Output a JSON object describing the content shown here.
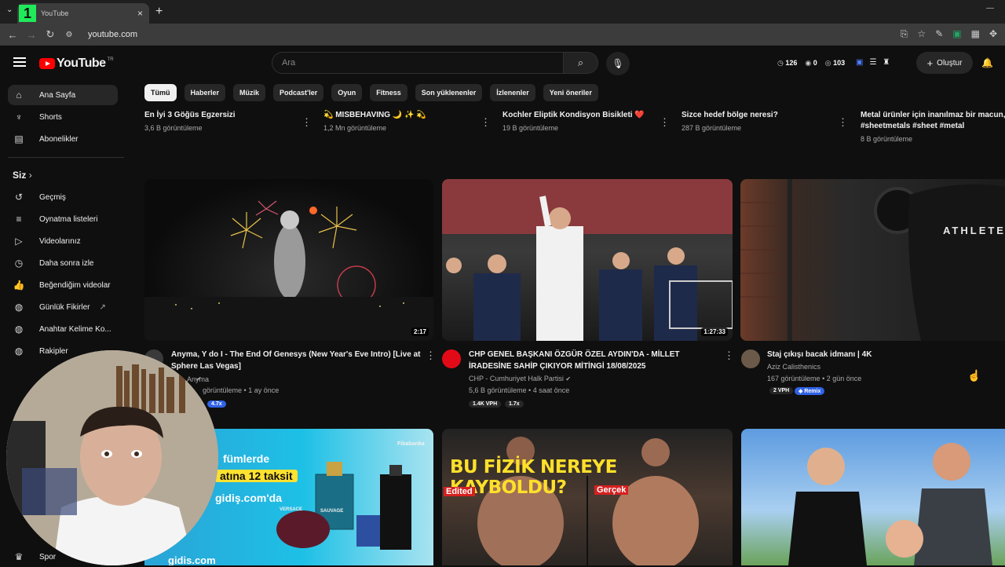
{
  "browser": {
    "tab_title": "YouTube",
    "tab_badge": "1",
    "url": "youtube.com"
  },
  "header": {
    "logo_text": "YouTube",
    "logo_region": "TR",
    "search_placeholder": "Ara",
    "stats": {
      "a": "126",
      "b": "0",
      "c": "103"
    },
    "create_label": "Oluştur"
  },
  "sidebar": {
    "top": [
      {
        "label": "Ana Sayfa",
        "icon": "home-icon"
      },
      {
        "label": "Shorts",
        "icon": "shorts-icon"
      },
      {
        "label": "Abonelikler",
        "icon": "subscriptions-icon"
      }
    ],
    "you_header": "Siz",
    "you": [
      {
        "label": "Geçmiş",
        "icon": "history-icon"
      },
      {
        "label": "Oynatma listeleri",
        "icon": "playlists-icon"
      },
      {
        "label": "Videolarınız",
        "icon": "your-videos-icon"
      },
      {
        "label": "Daha sonra izle",
        "icon": "watch-later-icon"
      },
      {
        "label": "Beğendiğim videolar",
        "icon": "liked-icon"
      },
      {
        "label": "Günlük Fikirler",
        "icon": "playlist-icon"
      },
      {
        "label": "Anahtar Kelime Ko...",
        "icon": "playlist-icon"
      },
      {
        "label": "Rakipler",
        "icon": "playlist-icon"
      }
    ],
    "bottom_label": "Spor"
  },
  "chips": [
    "Tümü",
    "Haberler",
    "Müzik",
    "Podcast'ler",
    "Oyun",
    "Fitness",
    "Son yüklenenler",
    "İzlenenler",
    "Yeni öneriler"
  ],
  "top_row": [
    {
      "title": "En İyi 3 Göğüs Egzersizi",
      "meta": "3,6 B görüntüleme"
    },
    {
      "title": "💫 MISBEHAVING 🌙 ✨ 💫",
      "meta": "1,2 Mn görüntüleme"
    },
    {
      "title": "Kochler Eliptik Kondisyon Bisikleti ❤️",
      "meta": "19 B görüntüleme"
    },
    {
      "title": "Sizce hedef bölge neresi?",
      "meta": "287 B görüntüleme"
    },
    {
      "title": "Metal ürünler için inanılmaz bir macun, #sheetmetals #sheet #metal",
      "meta": "8 B görüntüleme"
    }
  ],
  "videos": [
    {
      "title": "Anyma, Y do I - The End Of Genesys (New Year's Eve Intro) [Live at Sphere Las Vegas]",
      "channel": "Anyma",
      "views": "görüntüleme",
      "age": "1 ay önce",
      "duration": "2:17",
      "pills": [
        "4.7x"
      ]
    },
    {
      "title": "CHP GENEL BAŞKANI ÖZGÜR ÖZEL AYDIN'DA - MİLLET İRADESİNE SAHİP ÇIKIYOR MİTİNGİ 18/08/2025",
      "channel": "CHP - Cumhuriyet Halk Partisi",
      "views": "5,6 B görüntüleme",
      "age": "4 saat önce",
      "duration": "1:27:33",
      "pills": [
        "1.4K VPH",
        "1.7x"
      ]
    },
    {
      "title": "Staj çıkışı bacak idmanı | 4K",
      "channel": "Aziz Calisthenics",
      "views": "167 görüntüleme",
      "age": "2 gün önce",
      "pills": [
        "2 VPH",
        "Remix"
      ]
    }
  ],
  "thumb_texts": {
    "shirt": "ATHLETE",
    "ad_line1": "fümlerde",
    "ad_line2": "atına 12 taksit",
    "ad_line3": "gidiş.com'da",
    "ad_brand": "Fibabanka",
    "ad_bottom": "gidis.com",
    "sauvage": "SAUVAGE",
    "versace": "VERSACE",
    "fizik": "BU FİZİK NEREYE KAYBOLDU?",
    "edited": "Edited",
    "gercek": "Gerçek"
  },
  "colors": {
    "bg": "#0f0f0f",
    "chip_bg": "#272727",
    "accent_red": "#ff0000",
    "remix_blue": "#3062e6"
  }
}
